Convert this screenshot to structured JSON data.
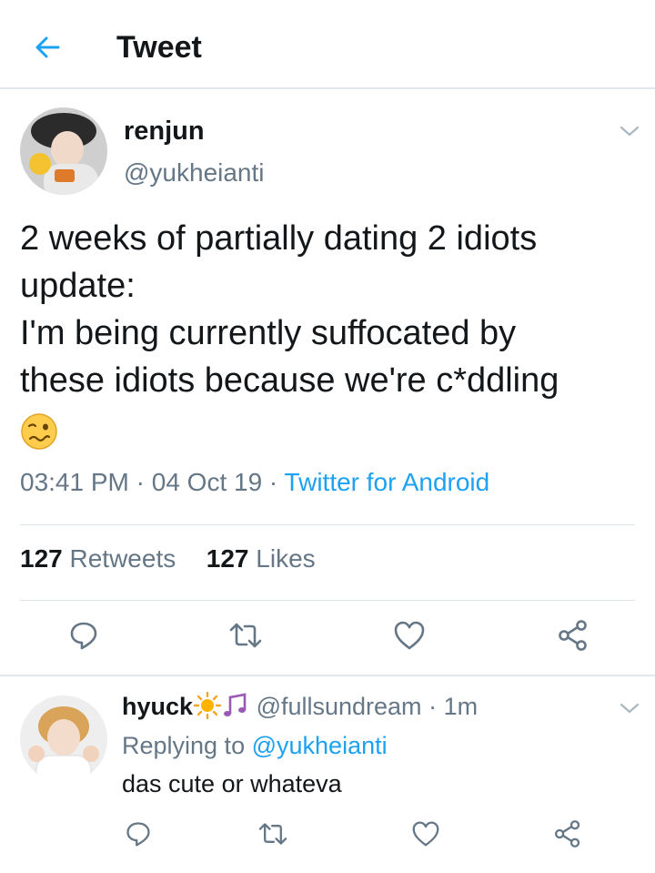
{
  "header": {
    "title": "Tweet"
  },
  "tweet": {
    "author_name": "renjun",
    "author_handle": "@yukheianti",
    "text_lines": [
      "2 weeks of partially dating 2 idiots",
      "update:",
      "I'm being currently suffocated by",
      "these idiots because we're c*ddling"
    ],
    "emoji": "woozy-face",
    "time": "03:41 PM",
    "date": "04 Oct 19",
    "source": "Twitter for Android",
    "retweets_count": "127",
    "retweets_label": "Retweets",
    "likes_count": "127",
    "likes_label": "Likes"
  },
  "reply": {
    "author_name": "hyuck",
    "author_emojis": [
      "sun",
      "musical-notes"
    ],
    "author_handle": "@fullsundream",
    "time_ago": "1m",
    "replying_prefix": "Replying to",
    "replying_handle": "@yukheianti",
    "text": "das cute or whateva"
  },
  "colors": {
    "accent": "#1da1f2",
    "secondary_text": "#657786",
    "divider": "#e1e8ed"
  }
}
